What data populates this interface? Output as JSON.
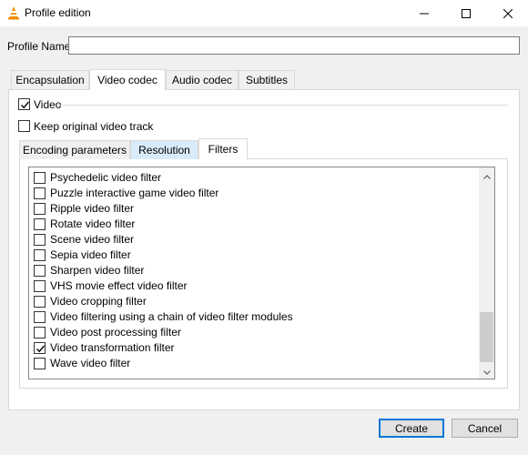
{
  "window": {
    "title": "Profile edition",
    "icon": "vlc-cone-icon"
  },
  "profile": {
    "label": "Profile Name",
    "value": "",
    "placeholder": ""
  },
  "tabs": [
    {
      "label": "Encapsulation",
      "active": false
    },
    {
      "label": "Video codec",
      "active": true
    },
    {
      "label": "Audio codec",
      "active": false
    },
    {
      "label": "Subtitles",
      "active": false
    }
  ],
  "video": {
    "enable_label": "Video",
    "enable_checked": true,
    "keep_label": "Keep original video track",
    "keep_checked": false
  },
  "subtabs": [
    {
      "label": "Encoding parameters",
      "active": false
    },
    {
      "label": "Resolution",
      "active": false,
      "hover": true
    },
    {
      "label": "Filters",
      "active": true
    }
  ],
  "filters": [
    {
      "label": "Psychedelic video filter",
      "checked": false
    },
    {
      "label": "Puzzle interactive game video filter",
      "checked": false
    },
    {
      "label": "Ripple video filter",
      "checked": false
    },
    {
      "label": "Rotate video filter",
      "checked": false
    },
    {
      "label": "Scene video filter",
      "checked": false
    },
    {
      "label": "Sepia video filter",
      "checked": false
    },
    {
      "label": "Sharpen video filter",
      "checked": false
    },
    {
      "label": "VHS movie effect video filter",
      "checked": false
    },
    {
      "label": "Video cropping filter",
      "checked": false
    },
    {
      "label": "Video filtering using a chain of video filter modules",
      "checked": false
    },
    {
      "label": "Video post processing filter",
      "checked": false
    },
    {
      "label": "Video transformation filter",
      "checked": true
    },
    {
      "label": "Wave video filter",
      "checked": false
    }
  ],
  "buttons": {
    "create": "Create",
    "cancel": "Cancel"
  },
  "colors": {
    "accent": "#0078d7",
    "hover_tab": "#d9ebf9"
  }
}
